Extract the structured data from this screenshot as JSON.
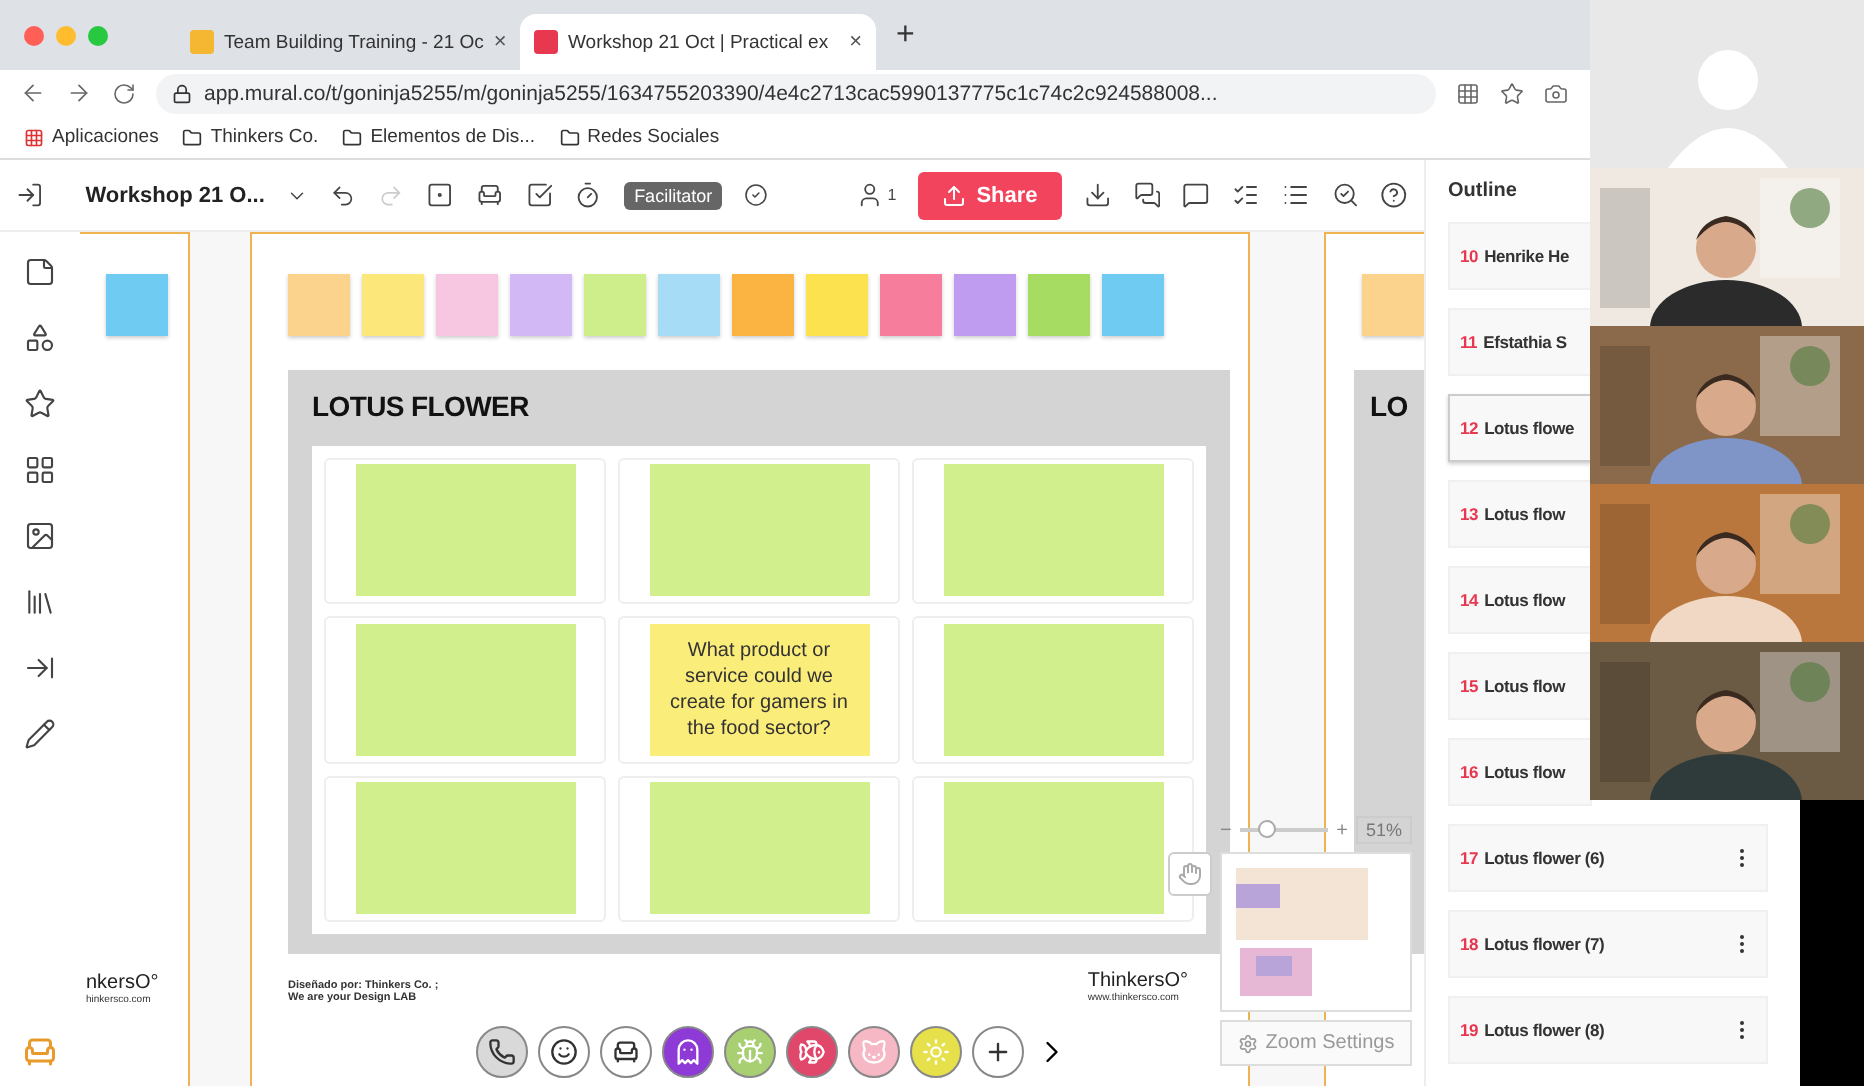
{
  "browser": {
    "tabs": [
      {
        "title": "Team Building Training - 21 Oc",
        "close": "×",
        "selected": false
      },
      {
        "title": "Workshop 21 Oct | Practical ex",
        "close": "×",
        "selected": true
      }
    ],
    "new_tab": "+",
    "address": "app.mural.co/t/goninja5255/m/goninja5255/1634755203390/4e4c2713cac5990137775c1c74c2c924588008...",
    "bookmarks": [
      "Aplicaciones",
      "Thinkers Co.",
      "Elementos de Dis...",
      "Redes Sociales"
    ]
  },
  "toolbar": {
    "board_title": "Workshop 21 O...",
    "facilitator": "Facilitator",
    "participants": "1",
    "share": "Share"
  },
  "canvas": {
    "palette": [
      {
        "color": "#fbd38d"
      },
      {
        "color": "#fbe77a"
      },
      {
        "color": "#f7c6e0"
      },
      {
        "color": "#d2b8f5"
      },
      {
        "color": "#cdee8a"
      },
      {
        "color": "#a6dcf5"
      },
      {
        "color": "#fbb441"
      },
      {
        "color": "#fbe24e"
      },
      {
        "color": "#f67e9c"
      },
      {
        "color": "#c09cf0"
      },
      {
        "color": "#a6dc62"
      },
      {
        "color": "#6fcbf1"
      }
    ],
    "board": {
      "title": "LOTUS FLOWER",
      "cells": [
        {
          "kind": "blank"
        },
        {
          "kind": "blank"
        },
        {
          "kind": "blank"
        },
        {
          "kind": "blank"
        },
        {
          "kind": "question",
          "text": "What product or service could we create for gamers in the food sector?"
        },
        {
          "kind": "blank"
        },
        {
          "kind": "blank"
        },
        {
          "kind": "blank"
        },
        {
          "kind": "blank"
        }
      ],
      "credit": "Diseñado por: Thinkers Co. ;",
      "tagline": "We are your Design LAB",
      "brand": "ThinkersO°",
      "website": "www.thinkersco.com"
    },
    "left_frame": {
      "brand": "nkersO°",
      "website": "hinkersco.com"
    },
    "right_frame": {
      "title": "LO"
    }
  },
  "collaborators": [
    {
      "kind": "phone",
      "color": "#d9d9d9"
    },
    {
      "kind": "smile",
      "color": "#ffffff"
    },
    {
      "kind": "table",
      "color": "#ffffff"
    },
    {
      "kind": "ghost",
      "color": "#8e3ad6"
    },
    {
      "kind": "bug",
      "color": "#a8d072"
    },
    {
      "kind": "fish",
      "color": "#e0476a"
    },
    {
      "kind": "cat",
      "color": "#f6b8c4"
    },
    {
      "kind": "sun",
      "color": "#e6e04a"
    },
    {
      "kind": "add",
      "color": "#ffffff"
    }
  ],
  "zoom": {
    "minus": "−",
    "plus": "+",
    "percent": "51%",
    "settings": "Zoom Settings",
    "level": 0.3
  },
  "outline": {
    "title": "Outline",
    "items": [
      {
        "number": "10",
        "label": "Henrike He",
        "selected": false
      },
      {
        "number": "11",
        "label": "Efstathia S",
        "selected": false
      },
      {
        "number": "12",
        "label": "Lotus flowe",
        "selected": true
      },
      {
        "number": "13",
        "label": "Lotus flow",
        "selected": false
      },
      {
        "number": "14",
        "label": "Lotus flow",
        "selected": false
      },
      {
        "number": "15",
        "label": "Lotus flow",
        "selected": false
      },
      {
        "number": "16",
        "label": "Lotus flow",
        "selected": false
      },
      {
        "number": "17",
        "label": "Lotus flower (6)",
        "selected": false
      },
      {
        "number": "18",
        "label": "Lotus flower (7)",
        "selected": false
      },
      {
        "number": "19",
        "label": "Lotus flower (8)",
        "selected": false
      }
    ]
  },
  "videos": [
    {
      "kind": "avatar"
    },
    {
      "kind": "picture"
    },
    {
      "kind": "picture"
    },
    {
      "kind": "picture"
    },
    {
      "kind": "picture"
    }
  ]
}
